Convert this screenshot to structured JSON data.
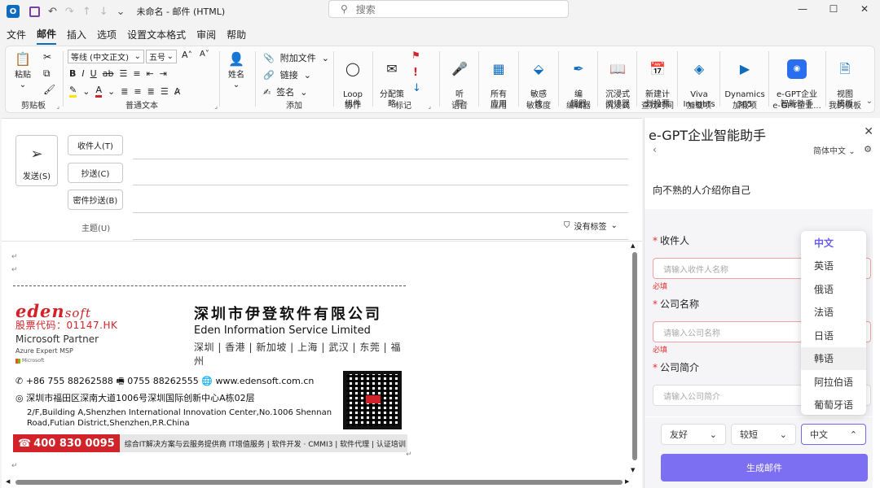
{
  "titlebar": {
    "app_icon": "O",
    "doc_title": "未命名 - 邮件 (HTML)",
    "search_placeholder": "搜索"
  },
  "menu": [
    "文件",
    "邮件",
    "插入",
    "选项",
    "设置文本格式",
    "审阅",
    "帮助"
  ],
  "ribbon": {
    "paste": "粘贴",
    "clipboard_group": "剪贴板",
    "font_name": "等线 (中文正文)",
    "font_size": "五号",
    "basic_text_group": "普通文本",
    "name_btn": "姓名",
    "attach_file": "附加文件",
    "link": "链接",
    "signature": "签名",
    "add_group": "添加",
    "loop_btn": "Loop\n组件",
    "collab_group": "协作",
    "assign_policy": "分配策\n略",
    "tags_group": "标记",
    "dictate": "听\n写",
    "voice_group": "语音",
    "all_apps": "所有\n应用",
    "apps_group": "应用",
    "sensitivity_btn": "敏感\n性",
    "sensitivity_group": "敏感度",
    "editor_btn": "编\n辑器",
    "editor_group": "编辑器",
    "immersive_btn": "沉浸式\n阅读器",
    "immersive_group": "沉浸式",
    "schedule_btn": "新建计\n划投票",
    "schedule_group": "查找时间",
    "viva_btn": "Viva\nInsights",
    "viva_group": "加载项",
    "dynamics_btn": "Dynamics\n365",
    "dynamics_group": "加载项",
    "egpt_btn": "e-GPT企业\n智能助手",
    "egpt_group": "e-GPT企业...",
    "template_btn": "视图\n模板",
    "template_group": "我的模板"
  },
  "compose": {
    "send": "发送(S)",
    "to": "收件人(T)",
    "cc": "抄送(C)",
    "bcc": "密件抄送(B)",
    "subject": "主题(U)",
    "tag": "没有标签",
    "para_mark": "↵"
  },
  "signature": {
    "logo_main": "eden",
    "logo_sub": "soft",
    "stock": "股票代码：01147.HK",
    "ms_partner": "Microsoft Partner",
    "ms_sub": "Azure Expert MSP",
    "ms_logo_text": "Microsoft",
    "company_cn": "深圳市伊登软件有限公司",
    "company_en": "Eden Information Service Limited",
    "cities": "深圳 | 香港 | 新加坡 | 上海 | 武汉 | 东莞 | 福州",
    "contact": "✆ +86 755 88262588  🖷 0755 88262555  🌐 www.edensoft.com.cn",
    "addr_cn": "◎ 深圳市福田区深南大道1006号深圳国际创新中心A栋02层",
    "addr_en": "2/F,Building A,Shenzhen International Innovation Center,No.1006 Shennan Road,Futian District,Shenzhen,P.R.China",
    "hotline": "400 830 0095",
    "slogan": "综合IT解决方案与云服务提供商  IT增值服务 | 软件开发 · CMMI3 | 软件代理 | 认证培训"
  },
  "panel": {
    "title": "e-GPT企业智能助手",
    "lang": "简体中文",
    "intro": "向不熟的人介绍你自己",
    "fields": [
      {
        "label": "收件人",
        "placeholder": "请输入收件人名称",
        "error": "必填"
      },
      {
        "label": "公司名称",
        "placeholder": "请输入公司名称",
        "error": "必填"
      },
      {
        "label": "公司简介",
        "placeholder": "请输入公司简介",
        "error": ""
      }
    ],
    "tone": "友好",
    "length": "较短",
    "output_lang": "中文",
    "generate": "生成邮件",
    "lang_options": [
      "中文",
      "英语",
      "俄语",
      "法语",
      "日语",
      "韩语",
      "阿拉伯语",
      "葡萄牙语"
    ],
    "accent_color": "#7c6ff2"
  }
}
